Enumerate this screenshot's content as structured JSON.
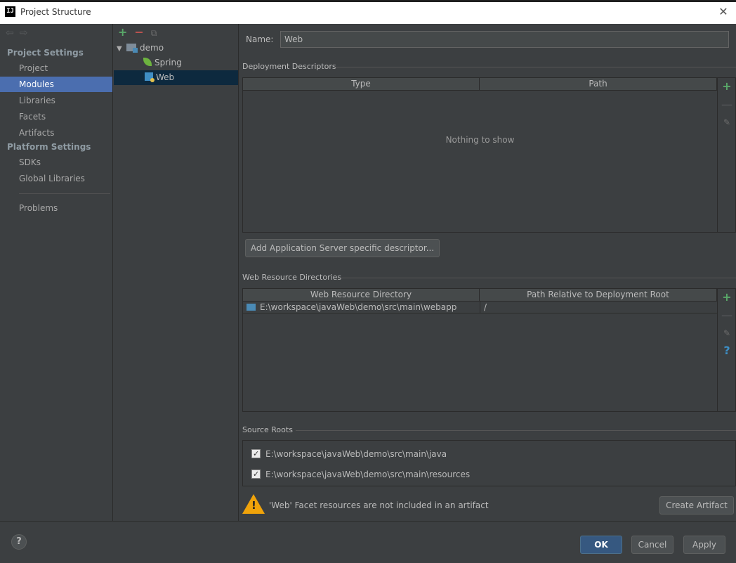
{
  "window": {
    "app_icon": "IJ",
    "title": "Project Structure",
    "close_glyph": "✕"
  },
  "nav": {
    "back_glyph": "⇦",
    "forward_glyph": "⇨",
    "project_settings_heading": "Project Settings",
    "project_items": [
      {
        "label": "Project",
        "selected": false
      },
      {
        "label": "Modules",
        "selected": true
      },
      {
        "label": "Libraries",
        "selected": false
      },
      {
        "label": "Facets",
        "selected": false
      },
      {
        "label": "Artifacts",
        "selected": false
      }
    ],
    "platform_settings_heading": "Platform Settings",
    "platform_items": [
      {
        "label": "SDKs"
      },
      {
        "label": "Global Libraries"
      }
    ],
    "problems_label": "Problems"
  },
  "tree": {
    "toolbar": {
      "add": "+",
      "remove": "−",
      "copy": "⧉"
    },
    "root_label": "demo",
    "children": [
      {
        "label": "Spring",
        "icon": "spring-icon",
        "selected": false
      },
      {
        "label": "Web",
        "icon": "web-facet-icon",
        "selected": true
      }
    ]
  },
  "facet": {
    "name_label": "Name:",
    "name_value": "Web",
    "deployment_descriptors": {
      "title": "Deployment Descriptors",
      "columns": [
        "Type",
        "Path"
      ],
      "empty_text": "Nothing to show",
      "add_button": "Add Application Server specific descriptor..."
    },
    "web_resource_dirs": {
      "title": "Web Resource Directories",
      "columns": [
        "Web Resource Directory",
        "Path Relative to Deployment Root"
      ],
      "rows": [
        {
          "directory": "E:\\workspace\\javaWeb\\demo\\src\\main\\webapp",
          "path": "/"
        }
      ]
    },
    "source_roots": {
      "title": "Source Roots",
      "items": [
        {
          "path": "E:\\workspace\\javaWeb\\demo\\src\\main\\java",
          "checked": true
        },
        {
          "path": "E:\\workspace\\javaWeb\\demo\\src\\main\\resources",
          "checked": true
        }
      ]
    },
    "warning_text": "'Web' Facet resources are not included in an artifact",
    "create_artifact_button": "Create Artifact"
  },
  "side_tools": {
    "add": "+",
    "remove": "—",
    "edit": "✎",
    "help": "?"
  },
  "footer": {
    "help_glyph": "?",
    "ok": "OK",
    "cancel": "Cancel",
    "apply": "Apply"
  }
}
